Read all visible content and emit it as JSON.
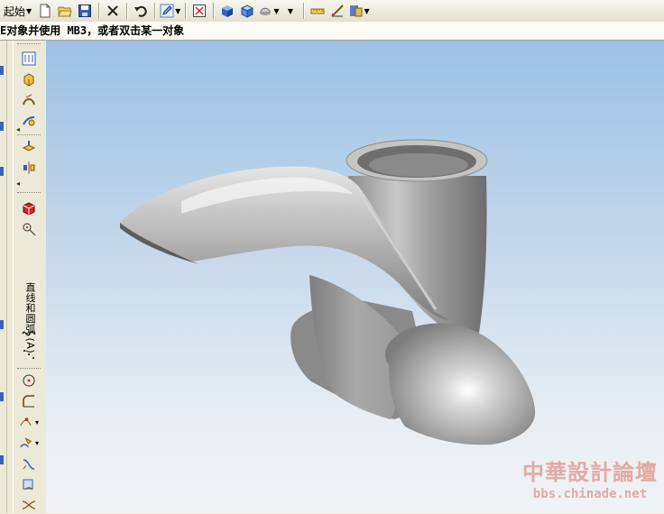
{
  "toolbar": {
    "start_label": "起始",
    "icons": [
      "new-file-icon",
      "open-folder-icon",
      "save-icon",
      "delete-icon",
      "undo-icon",
      "edit-pencil-icon",
      "fit-view-icon",
      "shaded-box-icon",
      "wireframe-box-icon",
      "render-style-icon",
      "measure-icon",
      "analysis-icon",
      "display-icon"
    ]
  },
  "cue_line": {
    "text": "E对象并使用 MB3，或者双击某一对象"
  },
  "left_toolbar": {
    "vertical_label": "直线和圆弧 (A)"
  },
  "watermark": {
    "title": "中華設計論壇",
    "url": "bbs.chinade.net"
  },
  "colors": {
    "viewport_top": "#9cc1e4",
    "viewport_bottom": "#f0f2f4",
    "model_gray": "#a6a6a6",
    "watermark": "#e3aaa6"
  }
}
